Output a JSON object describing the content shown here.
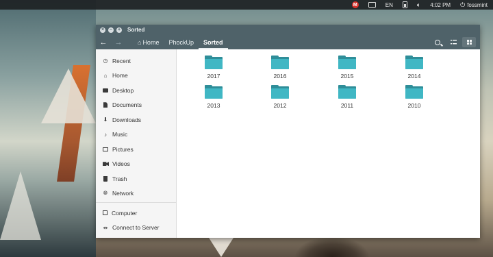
{
  "panel": {
    "keyboard_layout": "EN",
    "clock": "4:02 PM",
    "user": "fossmint",
    "badge_letter": "M"
  },
  "window": {
    "title": "Sorted",
    "title_buttons": [
      "close-icon",
      "minimize-icon",
      "maximize-icon"
    ]
  },
  "toolbar": {
    "breadcrumbs": [
      {
        "label": "Home",
        "icon": "home-icon",
        "active": false
      },
      {
        "label": "PhockUp",
        "active": false
      },
      {
        "label": "Sorted",
        "active": true
      }
    ]
  },
  "sidebar": {
    "places": [
      {
        "label": "Recent",
        "icon": "recent-icon"
      },
      {
        "label": "Home",
        "icon": "home-icon"
      },
      {
        "label": "Desktop",
        "icon": "desktop-icon"
      },
      {
        "label": "Documents",
        "icon": "documents-icon"
      },
      {
        "label": "Downloads",
        "icon": "downloads-icon"
      },
      {
        "label": "Music",
        "icon": "music-icon"
      },
      {
        "label": "Pictures",
        "icon": "pictures-icon"
      },
      {
        "label": "Videos",
        "icon": "videos-icon"
      },
      {
        "label": "Trash",
        "icon": "trash-icon"
      },
      {
        "label": "Network",
        "icon": "network-icon"
      }
    ],
    "devices": [
      {
        "label": "Computer",
        "icon": "computer-icon"
      },
      {
        "label": "Connect to Server",
        "icon": "connect-server-icon"
      }
    ]
  },
  "folders": [
    "2017",
    "2016",
    "2015",
    "2014",
    "2013",
    "2012",
    "2011",
    "2010"
  ],
  "colors": {
    "header": "#4f6269",
    "folder_front": "#40b7c4",
    "folder_back": "#2f8e99",
    "panel_badge": "#d9312b"
  }
}
